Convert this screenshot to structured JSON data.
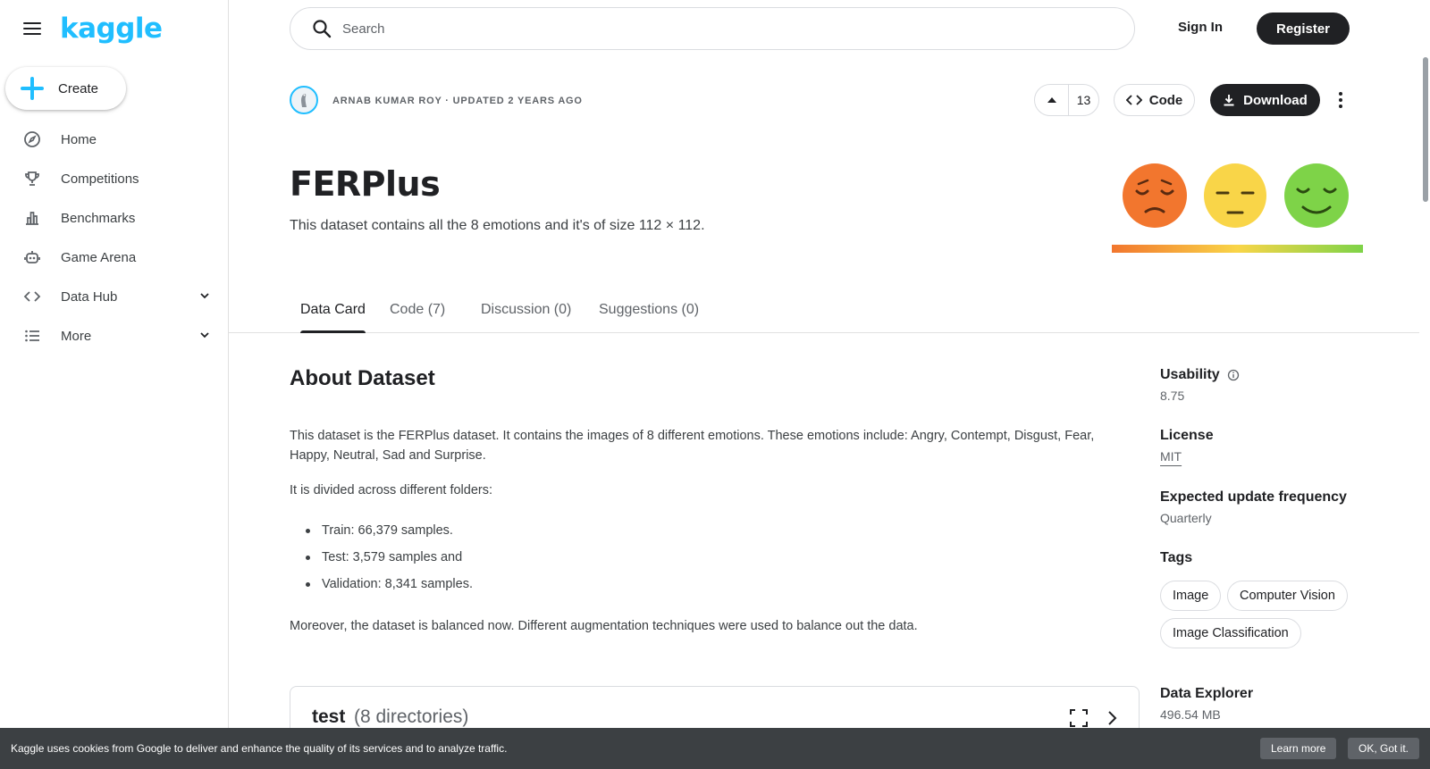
{
  "app": {
    "logo": "kaggle"
  },
  "sidebar": {
    "create_label": "Create",
    "items": [
      {
        "label": "Home",
        "icon": "compass-icon"
      },
      {
        "label": "Competitions",
        "icon": "trophy-icon"
      },
      {
        "label": "Benchmarks",
        "icon": "bar-chart-icon"
      },
      {
        "label": "Game Arena",
        "icon": "robot-icon"
      },
      {
        "label": "Data Hub",
        "icon": "code-brackets-icon"
      },
      {
        "label": "More",
        "icon": "list-icon"
      }
    ]
  },
  "search": {
    "placeholder": "Search"
  },
  "header": {
    "signin_label": "Sign In",
    "register_label": "Register"
  },
  "dataset": {
    "author_line": "ARNAB KUMAR ROY · UPDATED 2 YEARS AGO",
    "votes": "13",
    "code_label": "Code",
    "download_label": "Download",
    "title": "FERPlus",
    "subtitle": "This dataset contains all the 8 emotions and it's of size 112 × 112."
  },
  "tabs": [
    {
      "label": "Data Card"
    },
    {
      "label": "Code (7)"
    },
    {
      "label": "Discussion (0)"
    },
    {
      "label": "Suggestions (0)"
    }
  ],
  "about": {
    "heading": "About Dataset",
    "para1": "This dataset is the FERPlus dataset. It contains the images of 8 different emotions. These emotions include: Angry, Contempt, Disgust, Fear, Happy, Neutral, Sad and Surprise.",
    "para2": "It is divided across different folders:",
    "bullets": [
      "Train: 66,379 samples.",
      "Test: 3,579 samples and",
      "Validation: 8,341 samples."
    ],
    "para3": "Moreover, the dataset is balanced now. Different augmentation techniques were used to balance out the data."
  },
  "file_card": {
    "name": "test",
    "count": "(8 directories)"
  },
  "meta": {
    "usability_label": "Usability",
    "usability_value": "8.75",
    "license_label": "License",
    "license_value": "MIT",
    "update_label": "Expected update frequency",
    "update_value": "Quarterly",
    "tags_label": "Tags",
    "tags": [
      "Image",
      "Computer Vision",
      "Image Classification"
    ],
    "explorer_label": "Data Explorer",
    "explorer_size": "496.54 MB"
  },
  "cookie": {
    "text": "Kaggle uses cookies from Google to deliver and enhance the quality of its services and to analyze traffic.",
    "learn_more": "Learn more",
    "ok": "OK, Got it."
  },
  "colors": {
    "brand": "#20beff",
    "dark": "#202124",
    "face_orange": "#f2762e",
    "face_yellow": "#f9d548",
    "face_green": "#7ed348"
  }
}
